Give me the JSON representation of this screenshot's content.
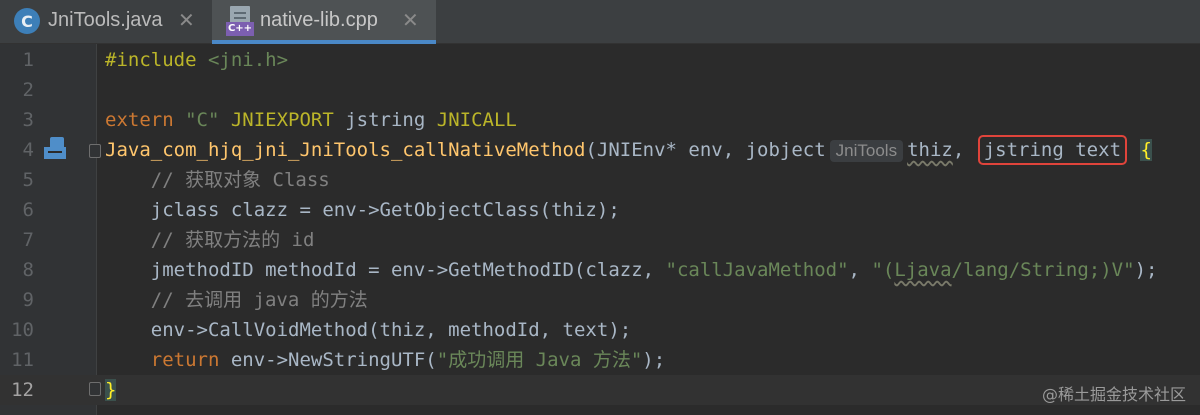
{
  "tabs": [
    {
      "label": "JniTools.java",
      "icon": "java-class-icon",
      "icon_letter": "C"
    },
    {
      "label": "native-lib.cpp",
      "icon": "cpp-file-icon",
      "badge": "C++",
      "active": true
    }
  ],
  "editor": {
    "current_line": 12,
    "lines": [
      {
        "num": "1",
        "tokens": [
          [
            "def",
            "#include "
          ],
          [
            "str",
            "<jni.h>"
          ]
        ]
      },
      {
        "num": "2",
        "tokens": []
      },
      {
        "num": "3",
        "tokens": [
          [
            "kw",
            "extern "
          ],
          [
            "str",
            "\"C\" "
          ],
          [
            "def",
            "JNIEXPORT "
          ],
          [
            "plain",
            "jstring "
          ],
          [
            "def",
            "JNICALL"
          ]
        ]
      },
      {
        "num": "4",
        "tokens": [
          [
            "fn",
            "Java_com_hjq_jni_JniTools_callNativeMethod"
          ],
          [
            "plain",
            "(JNIEnv* env, jobject"
          ],
          [
            "hint",
            "JniTools"
          ],
          [
            "squig",
            "thiz"
          ],
          [
            "plain",
            ", "
          ],
          [
            "boxed",
            "jstring text"
          ],
          [
            "plain",
            " "
          ],
          [
            "brace",
            "{"
          ]
        ]
      },
      {
        "num": "5",
        "tokens": [
          [
            "cmt",
            "    // 获取对象 Class"
          ]
        ]
      },
      {
        "num": "6",
        "tokens": [
          [
            "plain",
            "    jclass clazz = env->GetObjectClass(thiz);"
          ]
        ]
      },
      {
        "num": "7",
        "tokens": [
          [
            "cmt",
            "    // 获取方法的 id"
          ]
        ]
      },
      {
        "num": "8",
        "tokens": [
          [
            "plain",
            "    jmethodID methodId = env->GetMethodID(clazz, "
          ],
          [
            "str",
            "\"callJavaMethod\""
          ],
          [
            "plain",
            ", "
          ],
          [
            "str",
            "\"("
          ],
          [
            "strsquig",
            "Ljava"
          ],
          [
            "str",
            "/lang/String;)V\""
          ],
          [
            "plain",
            ");"
          ]
        ]
      },
      {
        "num": "9",
        "tokens": [
          [
            "cmt",
            "    // 去调用 java 的方法"
          ]
        ]
      },
      {
        "num": "10",
        "tokens": [
          [
            "plain",
            "    env->CallVoidMethod(thiz, methodId, text);"
          ]
        ]
      },
      {
        "num": "11",
        "tokens": [
          [
            "kw",
            "    return "
          ],
          [
            "plain",
            "env->NewStringUTF("
          ],
          [
            "str",
            "\"成功调用 Java 方法\""
          ],
          [
            "plain",
            ");"
          ]
        ]
      },
      {
        "num": "12",
        "tokens": [
          [
            "caret",
            "}"
          ]
        ]
      }
    ]
  },
  "gutter_icon": "implementation-marker-icon",
  "watermark": "@稀土掘金技术社区",
  "colors": {
    "background": "#2b2b2b",
    "keyword": "#cc7832",
    "string": "#6a8759",
    "comment": "#808080",
    "function": "#ffc66d",
    "macro": "#bbb529",
    "highlight_box": "#e0443b",
    "active_tab_underline": "#4a88c7"
  }
}
